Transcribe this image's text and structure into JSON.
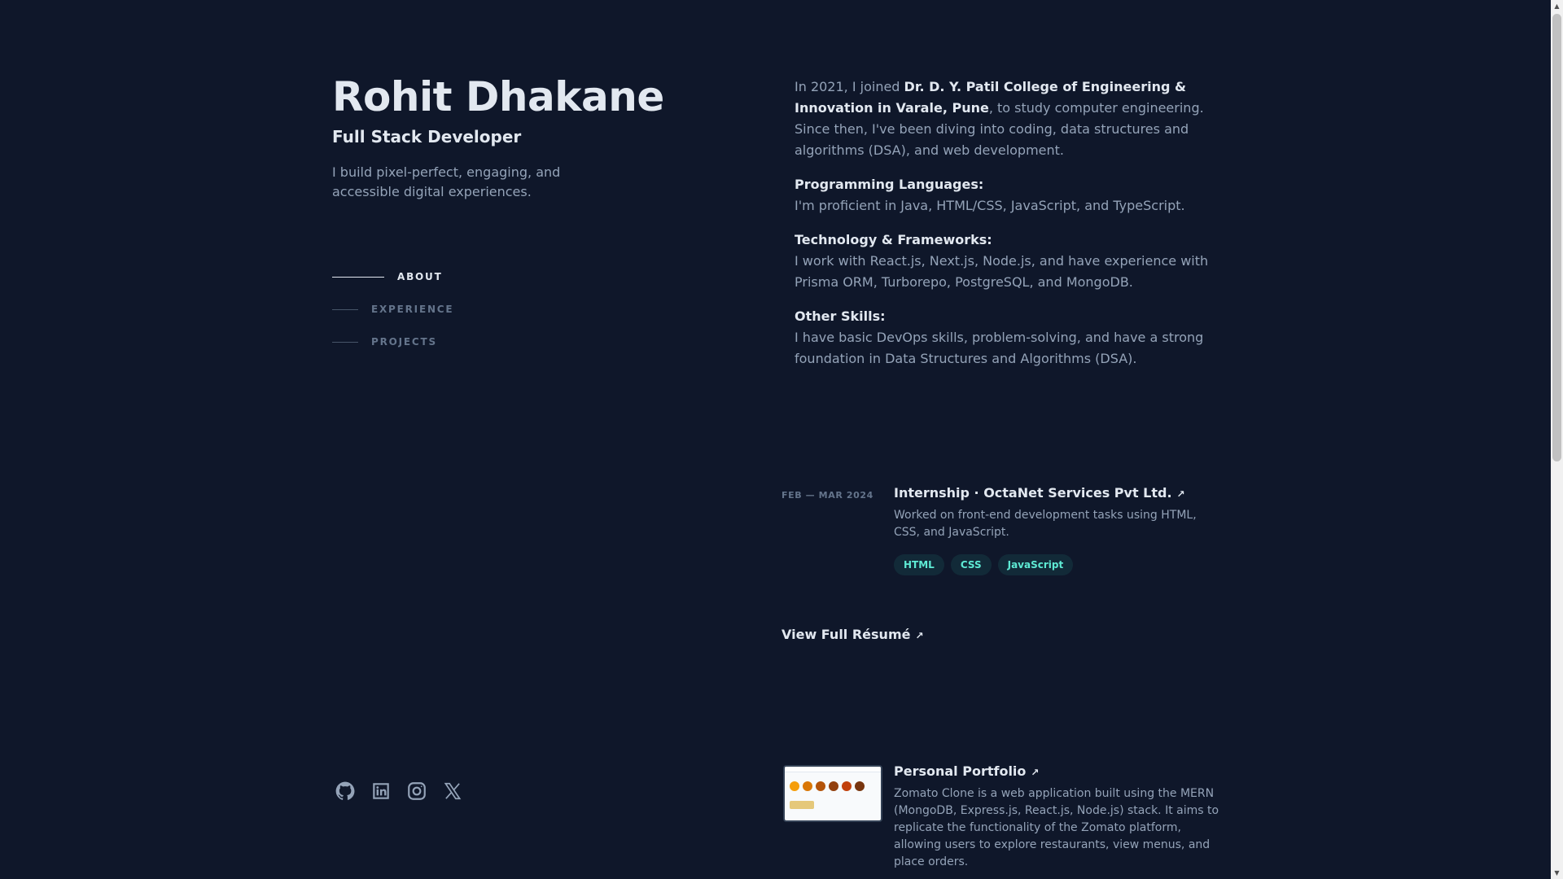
{
  "header": {
    "name": "Rohit Dhakane",
    "role": "Full Stack Developer",
    "tagline": "I build pixel-perfect, engaging, and accessible digital experiences."
  },
  "nav": {
    "items": [
      {
        "label": "ABOUT",
        "active": true
      },
      {
        "label": "EXPERIENCE",
        "active": false
      },
      {
        "label": "PROJECTS",
        "active": false
      }
    ]
  },
  "socials": [
    {
      "icon": "github-icon"
    },
    {
      "icon": "linkedin-icon"
    },
    {
      "icon": "instagram-icon"
    },
    {
      "icon": "x-icon"
    }
  ],
  "about": {
    "intro_prefix": "In 2021, I joined ",
    "college": "Dr. D. Y. Patil College of Engineering & Innovation in Varale, Pune",
    "intro_suffix": ", to study computer engineering. Since then, I've been diving into coding, data structures and algorithms (DSA), and web development.",
    "languages_heading": "Programming Languages:",
    "languages_text": "I'm proficient in Java, HTML/CSS, JavaScript, and TypeScript.",
    "frameworks_heading": "Technology & Frameworks:",
    "frameworks_text": "I work with React.js, Next.js, Node.js, and have experience with Prisma ORM, Turborepo, PostgreSQL, and MongoDB.",
    "other_heading": "Other Skills:",
    "other_text": "I have basic DevOps skills, problem-solving, and have a strong foundation in Data Structures and Algorithms (DSA)."
  },
  "experience": {
    "date": "FEB — MAR 2024",
    "title": "Internship · OctaNet Services Pvt Ltd.",
    "arrow": "↗",
    "description": "Worked on front-end development tasks using HTML, CSS, and JavaScript.",
    "tags": [
      "HTML",
      "CSS",
      "JavaScript"
    ]
  },
  "resume": {
    "label": "View Full Résumé",
    "arrow": "↗"
  },
  "project": {
    "title": "Personal Portfolio",
    "arrow": "↗",
    "description": "Zomato Clone is a web application built using the MERN (MongoDB, Express.js, React.js, Node.js) stack. It aims to replicate the functionality of the Zomato platform, allowing users to explore restaurants, view menus, and place orders."
  },
  "colors": {
    "background": "#0f172a",
    "heading": "#e2e8f0",
    "body": "#94a3b8",
    "accent": "#5eead4"
  }
}
